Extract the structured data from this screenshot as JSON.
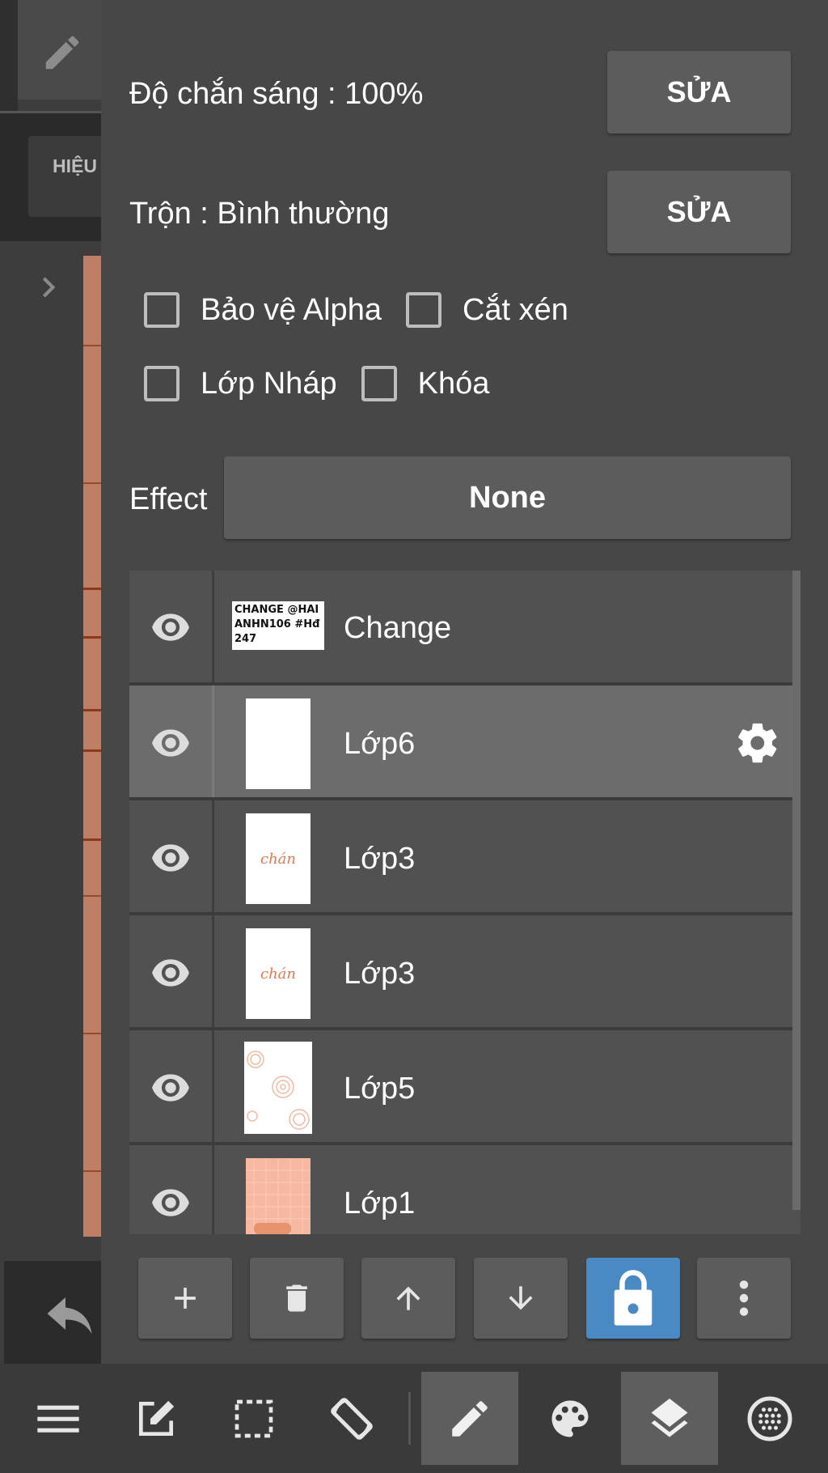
{
  "sidebar": {
    "effect_tab_label": "HIỆU"
  },
  "properties": {
    "opacity_label": "Độ chắn sáng : 100%",
    "blend_label": "Trộn : Bình thường",
    "edit_button_label": "SỬA",
    "effect_label": "Effect",
    "effect_value": "None",
    "checkboxes": [
      {
        "label": "Bảo vệ Alpha",
        "checked": false
      },
      {
        "label": "Cắt xén",
        "checked": false
      },
      {
        "label": "Lớp Nháp",
        "checked": false
      },
      {
        "label": "Khóa",
        "checked": false
      }
    ]
  },
  "layers": [
    {
      "name": "Change",
      "thumb_text": "CHANGE @HAIANHN106 #Hđ247",
      "selected": false
    },
    {
      "name": "Lớp6",
      "selected": true
    },
    {
      "name": "Lớp3",
      "thumb_text": "chán",
      "selected": false
    },
    {
      "name": "Lớp3",
      "thumb_text": "chán",
      "selected": false
    },
    {
      "name": "Lớp5",
      "selected": false
    },
    {
      "name": "Lớp1",
      "selected": false
    }
  ],
  "colors": {
    "panel_bg": "#474747",
    "button_bg": "#5c5c5c",
    "selected_row": "#6c6c6c",
    "active_blue": "#4a8ac4",
    "accent_orange": "#e07a4f"
  },
  "action_bar": [
    "add-layer",
    "delete-layer",
    "move-up",
    "move-down",
    "lock",
    "more"
  ],
  "toolbar": [
    "menu",
    "edit",
    "selection",
    "rotate",
    "pen",
    "palette",
    "layers",
    "grid"
  ]
}
